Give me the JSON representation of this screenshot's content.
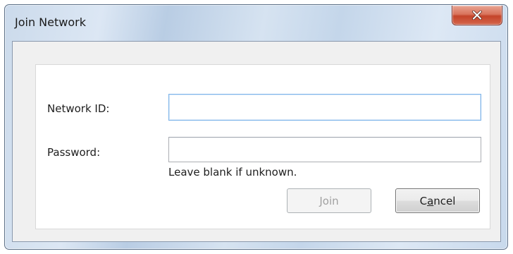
{
  "window": {
    "title": "Join Network",
    "close_icon": "close-x-icon"
  },
  "form": {
    "network_id": {
      "label": "Network ID:",
      "value": "",
      "placeholder": ""
    },
    "password": {
      "label": "Password:",
      "value": "",
      "placeholder": "",
      "hint": "Leave blank if unknown."
    }
  },
  "buttons": {
    "join": {
      "label_mnemonic": "J",
      "label_rest": "oin",
      "enabled": false
    },
    "cancel": {
      "label_pre": "C",
      "label_mnemonic": "a",
      "label_rest": "ncel",
      "enabled": true
    }
  },
  "colors": {
    "titlebar": "#cbdaeb",
    "close_button": "#c4442a",
    "client_bg": "#f0f0f0",
    "group_bg": "#ffffff",
    "focus_border": "#7eb4ea",
    "disabled_text": "#a0a0a0"
  }
}
